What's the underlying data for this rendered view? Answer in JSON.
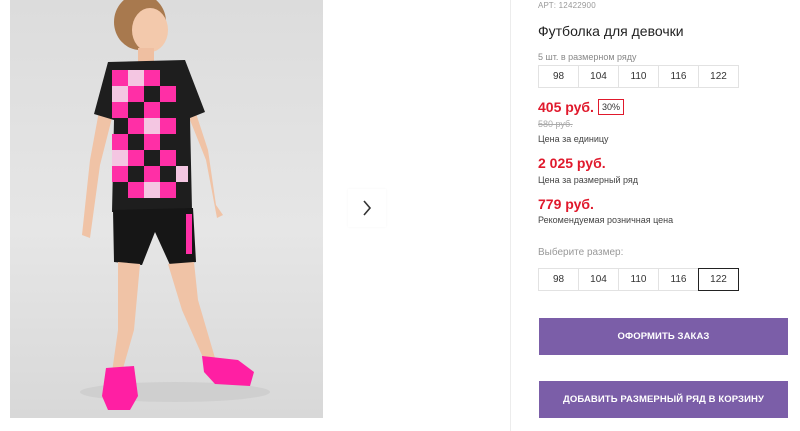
{
  "product": {
    "article": "АРТ: 12422900",
    "title": "Футболка для девочки",
    "set_count": "5 шт. в размерном ряду",
    "set_sizes": [
      "98",
      "104",
      "110",
      "116",
      "122"
    ]
  },
  "pricing": {
    "unit_price": "405 руб.",
    "discount": "30%",
    "old_price": "580 руб.",
    "unit_price_note": "Цена за единицу",
    "set_price": "2 025 руб.",
    "set_price_note": "Цена за размерный ряд",
    "retail_price": "779 руб.",
    "retail_price_note": "Рекомендуемая розничная цена",
    "accent_color": "#e0192c"
  },
  "size_picker": {
    "label": "Выберите размер:",
    "options": [
      "98",
      "104",
      "110",
      "116",
      "122"
    ],
    "selected": "122"
  },
  "actions": {
    "order_label": "ОФОРМИТЬ ЗАКАЗ",
    "add_set_label": "ДОБАВИТЬ РАЗМЕРНЫЙ РЯД В КОРЗИНУ",
    "button_color": "#7b5ea8"
  },
  "gallery": {
    "next_icon": "chevron-right-icon"
  }
}
